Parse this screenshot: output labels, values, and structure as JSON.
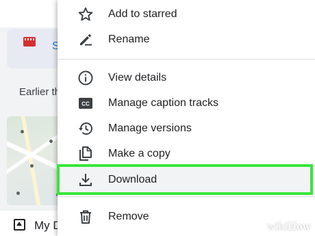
{
  "background": {
    "file_name": "S",
    "section_label": "Earlier th",
    "bottom_label": "My D"
  },
  "menu": {
    "items": [
      {
        "key": "starred",
        "label": "Add to starred",
        "icon": "star-outline-icon"
      },
      {
        "key": "rename",
        "label": "Rename",
        "icon": "pencil-icon"
      },
      {
        "key": "details",
        "label": "View details",
        "icon": "info-icon"
      },
      {
        "key": "captions",
        "label": "Manage caption tracks",
        "icon": "cc-icon"
      },
      {
        "key": "versions",
        "label": "Manage versions",
        "icon": "history-icon"
      },
      {
        "key": "copy",
        "label": "Make a copy",
        "icon": "copy-icon"
      },
      {
        "key": "download",
        "label": "Download",
        "icon": "download-icon",
        "highlighted": true
      },
      {
        "key": "remove",
        "label": "Remove",
        "icon": "trash-icon"
      }
    ]
  },
  "watermark": {
    "prefix": "wiki",
    "suffix": "How"
  },
  "colors": {
    "highlight_outline": "#38e63a",
    "file_icon": "#d32f2f",
    "link": "#1a73e8"
  }
}
